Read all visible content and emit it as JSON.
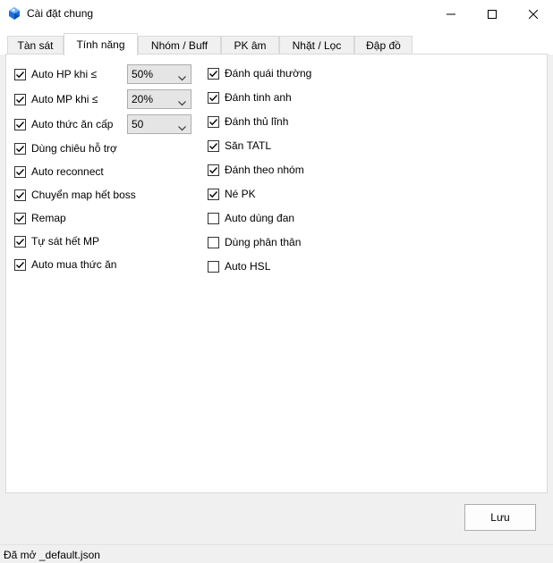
{
  "window": {
    "title": "Cài đặt chung"
  },
  "tabs": [
    {
      "label": "Tàn sát"
    },
    {
      "label": "Tính năng"
    },
    {
      "label": "Nhóm / Buff"
    },
    {
      "label": "PK âm"
    },
    {
      "label": "Nhặt / Lọc"
    },
    {
      "label": "Đập đồ"
    }
  ],
  "active_tab": "Tính năng",
  "left_options": [
    {
      "label": "Auto HP khi ≤",
      "checked": true
    },
    {
      "label": "Auto MP khi ≤",
      "checked": true
    },
    {
      "label": "Auto thức ăn cấp",
      "checked": true
    },
    {
      "label": "Dùng chiêu hỗ trợ",
      "checked": true
    },
    {
      "label": "Auto reconnect",
      "checked": true
    },
    {
      "label": "Chuyển map hết boss",
      "checked": true
    },
    {
      "label": "Remap",
      "checked": true
    },
    {
      "label": "Tự sát hết MP",
      "checked": true
    },
    {
      "label": "Auto mua thức ăn",
      "checked": true
    }
  ],
  "combos": {
    "hp_threshold": "50%",
    "mp_threshold": "20%",
    "food_level": "50"
  },
  "right_options": [
    {
      "label": "Đánh quái thường",
      "checked": true
    },
    {
      "label": "Đánh tinh anh",
      "checked": true
    },
    {
      "label": "Đánh thủ lĩnh",
      "checked": true
    },
    {
      "label": "Săn TATL",
      "checked": true
    },
    {
      "label": "Đánh theo nhóm",
      "checked": true
    },
    {
      "label": "Né PK",
      "checked": true
    },
    {
      "label": "Auto dùng đan",
      "checked": false
    },
    {
      "label": "Dùng phân thân",
      "checked": false
    },
    {
      "label": "Auto HSL",
      "checked": false
    }
  ],
  "buttons": {
    "save": "Lưu"
  },
  "status": {
    "text": "Đã mở _default.json"
  },
  "colors": {
    "accent_icon": "#1e6fd9",
    "border": "#d9d9d9"
  }
}
